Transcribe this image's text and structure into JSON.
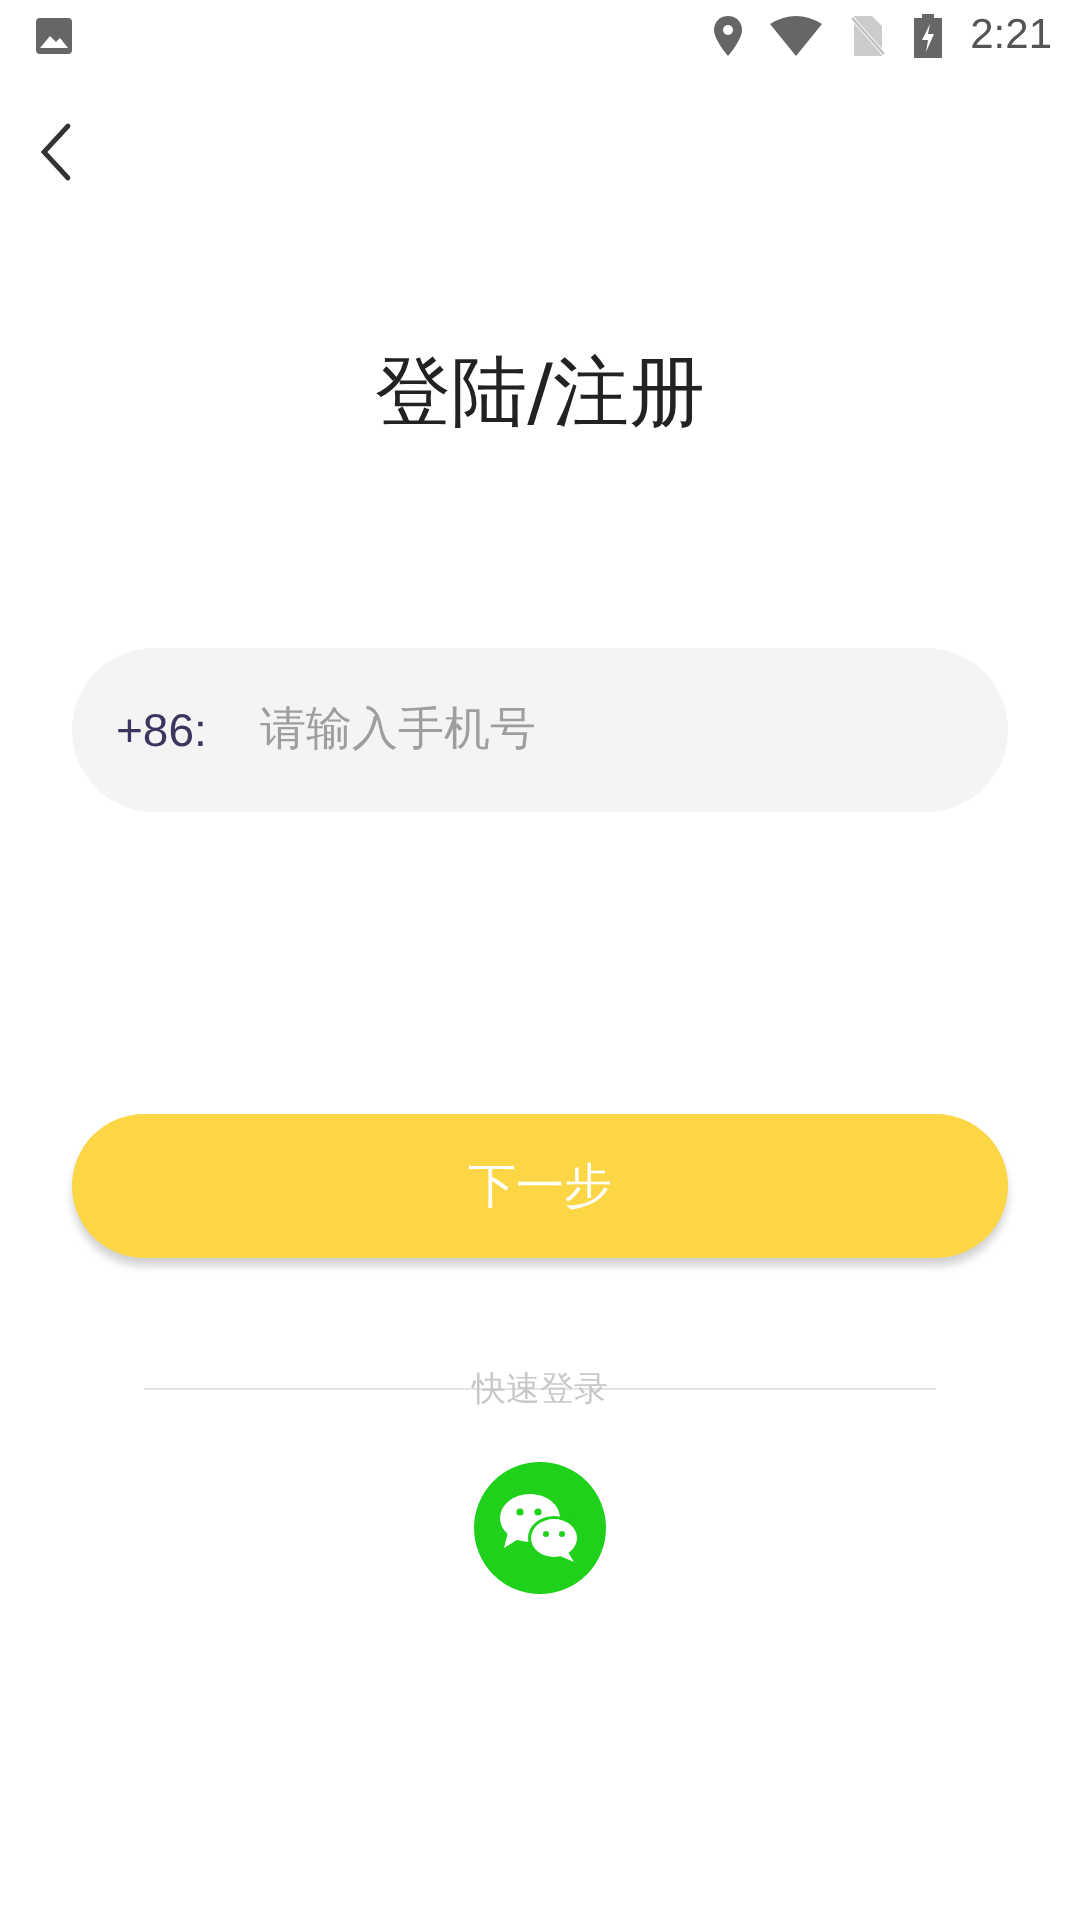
{
  "status_bar": {
    "time": "2:21"
  },
  "title": "登陆/注册",
  "phone_field": {
    "prefix": "+86:",
    "placeholder": "请输入手机号"
  },
  "next_button": {
    "label": "下一步"
  },
  "quick_login": {
    "label": "快速登录"
  }
}
